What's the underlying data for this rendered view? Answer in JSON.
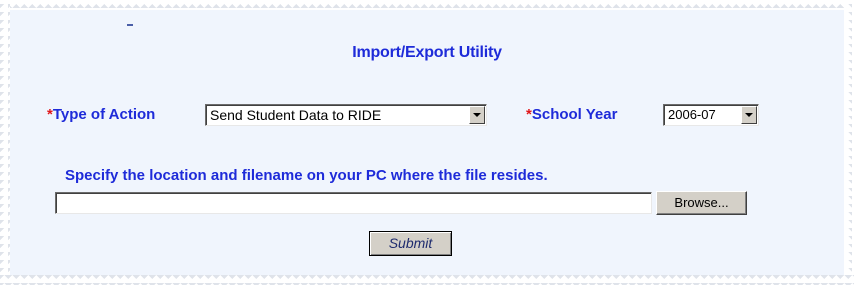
{
  "page": {
    "title": "Import/Export Utility"
  },
  "form": {
    "required_marker": "*",
    "action_label": "Type of Action",
    "action_selected": "Send Student Data to RIDE",
    "year_label": "School Year",
    "year_selected": "2006-07",
    "instructions": "Specify the location and filename on your PC where the file resides.",
    "file_value": "",
    "browse_label": "Browse...",
    "submit_label": "Submit"
  },
  "colors": {
    "label": "#1e2bd9",
    "required": "#e0161a",
    "panel_background": "#f0f5fd",
    "button_face": "#d4d0c8"
  },
  "icons": {
    "dropdown": "chevron-down-icon"
  }
}
